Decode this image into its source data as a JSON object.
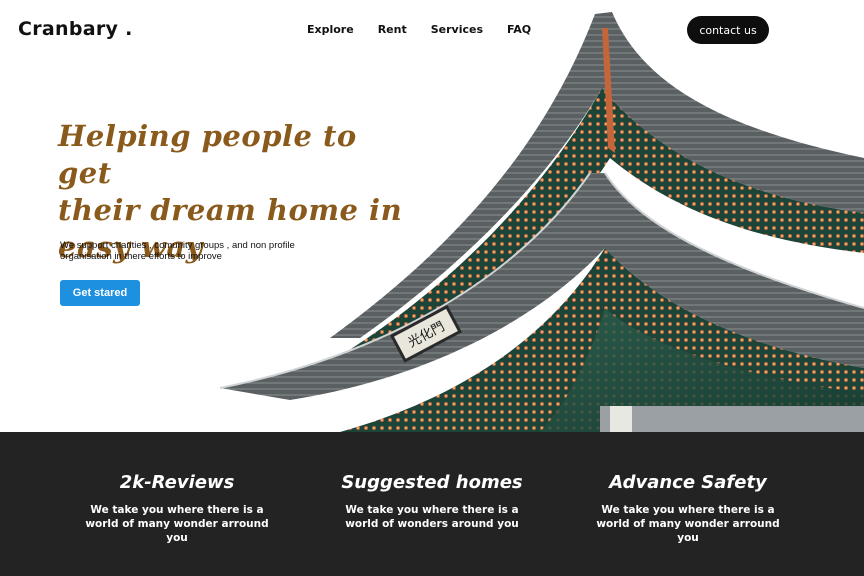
{
  "header": {
    "brand": "Cranbary .",
    "nav": [
      "Explore",
      "Rent",
      "Services",
      "FAQ"
    ],
    "contact_label": "contact us"
  },
  "hero": {
    "headline_lines": [
      "Helping people to get",
      "their dream home in",
      "easy way"
    ],
    "subtext": "We support charities , comunity groups , and non profile organisation in there efforts to improve",
    "cta_label": "Get stared",
    "sign_text": "光化門"
  },
  "features": [
    {
      "title": "2k-Reviews",
      "description": "We take you where there is a world of many wonder arround you"
    },
    {
      "title": "Suggested homes",
      "description": "We take you where there is a world of wonders around you"
    },
    {
      "title": "Advance Safety",
      "description": "We take you where there is a world of many wonder arround you"
    }
  ],
  "colors": {
    "headline": "#8a5a1c",
    "cta": "#1e90e0",
    "contact_button": "#0e0e0e",
    "features_background": "#232323",
    "roof_green": "#1f4f3f"
  },
  "icons": {
    "hero_image": "palace-roof-image"
  }
}
